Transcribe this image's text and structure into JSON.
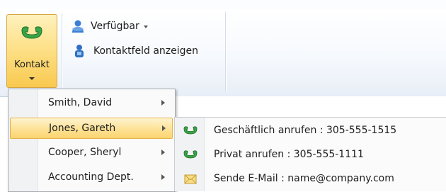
{
  "ribbon": {
    "contact_button": {
      "label": "Kontakt",
      "icon": "phone-handset-icon"
    },
    "presence": {
      "label": "Verfügbar",
      "icon": "presence-person-icon"
    },
    "contact_card": {
      "label": "Kontaktfeld anzeigen",
      "icon": "contact-card-person-icon"
    }
  },
  "contact_menu": {
    "items": [
      {
        "label": "Smith, David",
        "highlighted": false
      },
      {
        "label": "Jones, Gareth",
        "highlighted": true
      },
      {
        "label": "Cooper, Sheryl",
        "highlighted": false
      },
      {
        "label": "Accounting Dept.",
        "highlighted": false
      }
    ]
  },
  "submenu": {
    "items": [
      {
        "label": "Geschäftlich anrufen : 305-555-1515",
        "icon": "phone-handset-icon"
      },
      {
        "label": "Privat anrufen : 305-555-1111",
        "icon": "phone-handset-icon"
      },
      {
        "label": "Sende E-Mail : name@company.com",
        "icon": "envelope-icon"
      }
    ]
  },
  "colors": {
    "highlight_fill": "#fde39a",
    "highlight_border": "#e3b34a",
    "phone_green": "#2f9a3c"
  }
}
